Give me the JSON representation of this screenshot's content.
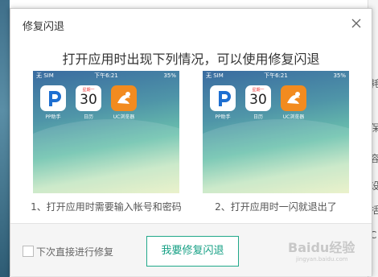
{
  "dialog": {
    "title": "修复闪退",
    "headline": "打开应用时出现下列情况，可以使用修复闪退"
  },
  "screenshots": [
    {
      "carrier": "无 SIM",
      "time": "下午6:21",
      "battery": "35%",
      "apps": [
        {
          "name": "PP助手",
          "icon": "pp-assistant-icon"
        },
        {
          "name": "日历",
          "icon": "calendar-icon",
          "weekday": "星期一",
          "day": "30"
        },
        {
          "name": "UC浏览器",
          "icon": "uc-browser-icon"
        }
      ],
      "caption": "1、打开应用时需要输入帐号和密码"
    },
    {
      "carrier": "无 SIM",
      "time": "下午6:21",
      "battery": "35%",
      "apps": [
        {
          "name": "PP助手",
          "icon": "pp-assistant-icon"
        },
        {
          "name": "日历",
          "icon": "calendar-icon",
          "weekday": "星期一",
          "day": "30"
        },
        {
          "name": "UC浏览器",
          "icon": "uc-browser-icon"
        }
      ],
      "caption": "2、打开应用时一闪就退出了"
    }
  ],
  "footer": {
    "checkbox_label": "下次直接进行修复",
    "checkbox_checked": false,
    "repair_button": "我要修复闪退",
    "watermark": "Baidu经验",
    "watermark_sub": "jingyan.baidu.com"
  },
  "background": {
    "right_edge_chars": [
      "耗",
      "保",
      "容",
      "设",
      "括",
      "C"
    ]
  },
  "colors": {
    "accent": "#16a085",
    "uc_orange": "#f28b1f",
    "pp_blue": "#1e6fd1"
  }
}
